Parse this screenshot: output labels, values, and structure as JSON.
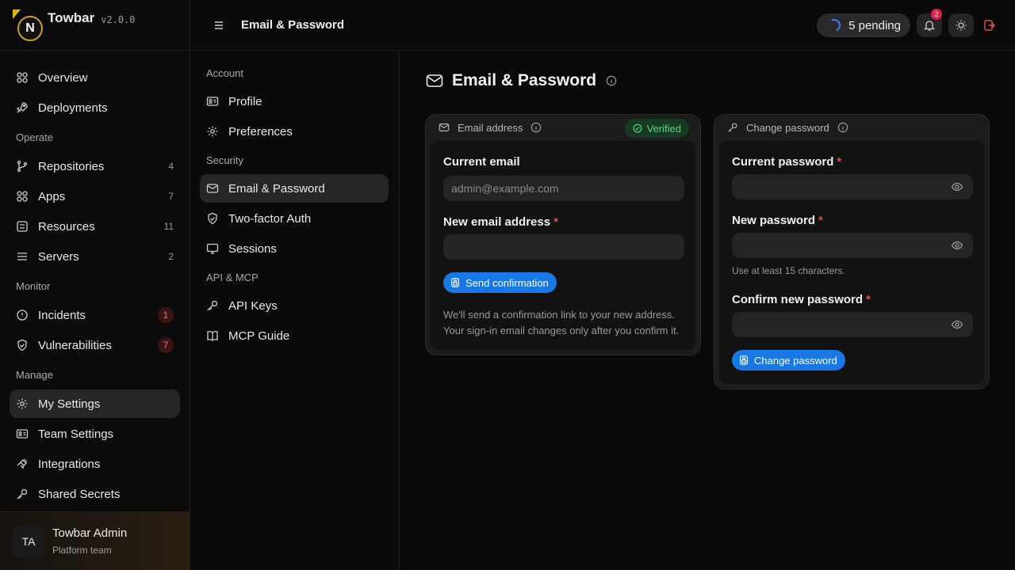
{
  "brand": {
    "logo_letter": "N",
    "name": "Towbar",
    "version": "v2.0.0"
  },
  "sidebar": {
    "items": [
      {
        "label": "Overview",
        "icon": "grid-icon"
      },
      {
        "label": "Deployments",
        "icon": "rocket-icon"
      }
    ],
    "sections": [
      {
        "title": "Operate",
        "items": [
          {
            "label": "Repositories",
            "count": "4",
            "icon": "git-branch-icon"
          },
          {
            "label": "Apps",
            "count": "7",
            "icon": "grid-icon"
          },
          {
            "label": "Resources",
            "count": "11",
            "icon": "database-icon"
          },
          {
            "label": "Servers",
            "count": "2",
            "icon": "server-icon"
          }
        ]
      },
      {
        "title": "Monitor",
        "items": [
          {
            "label": "Incidents",
            "count": "1",
            "icon": "alert-icon"
          },
          {
            "label": "Vulnerabilities",
            "count": "7",
            "icon": "shield-icon"
          }
        ]
      },
      {
        "title": "Manage",
        "items": [
          {
            "label": "My Settings",
            "icon": "gear-icon",
            "active": true
          },
          {
            "label": "Team Settings",
            "icon": "id-card-icon"
          },
          {
            "label": "Integrations",
            "icon": "plug-icon"
          },
          {
            "label": "Shared Secrets",
            "icon": "key-icon"
          }
        ]
      }
    ]
  },
  "user": {
    "initials": "TA",
    "name": "Towbar Admin",
    "team": "Platform team"
  },
  "topbar": {
    "title": "Email & Password",
    "pending": "5 pending",
    "notification_count": "2"
  },
  "subnav": {
    "sections": [
      {
        "title": "Account",
        "items": [
          {
            "label": "Profile"
          },
          {
            "label": "Preferences"
          }
        ]
      },
      {
        "title": "Security",
        "items": [
          {
            "label": "Email & Password",
            "active": true
          },
          {
            "label": "Two-factor Auth"
          },
          {
            "label": "Sessions"
          }
        ]
      },
      {
        "title": "API & MCP",
        "items": [
          {
            "label": "API Keys"
          },
          {
            "label": "MCP Guide"
          }
        ]
      }
    ]
  },
  "page": {
    "title": "Email & Password"
  },
  "email_card": {
    "header": "Email address",
    "status": "Verified",
    "current_label": "Current email",
    "current_value": "admin@example.com",
    "new_label": "New email address",
    "required_mark": "*",
    "new_value": "",
    "button": "Send confirmation",
    "help_line1": "We'll send a confirmation link to your new address.",
    "help_line2": "Your sign-in email changes only after you confirm it."
  },
  "password_card": {
    "header": "Change password",
    "current_label": "Current password",
    "new_label": "New password",
    "new_help": "Use at least 15 characters.",
    "confirm_label": "Confirm new password",
    "required_mark": "*",
    "button": "Change password"
  },
  "colors": {
    "accent": "#1778e6",
    "danger": "#ef4444",
    "success": "#5fd38a",
    "background": "#0a0a0a"
  }
}
